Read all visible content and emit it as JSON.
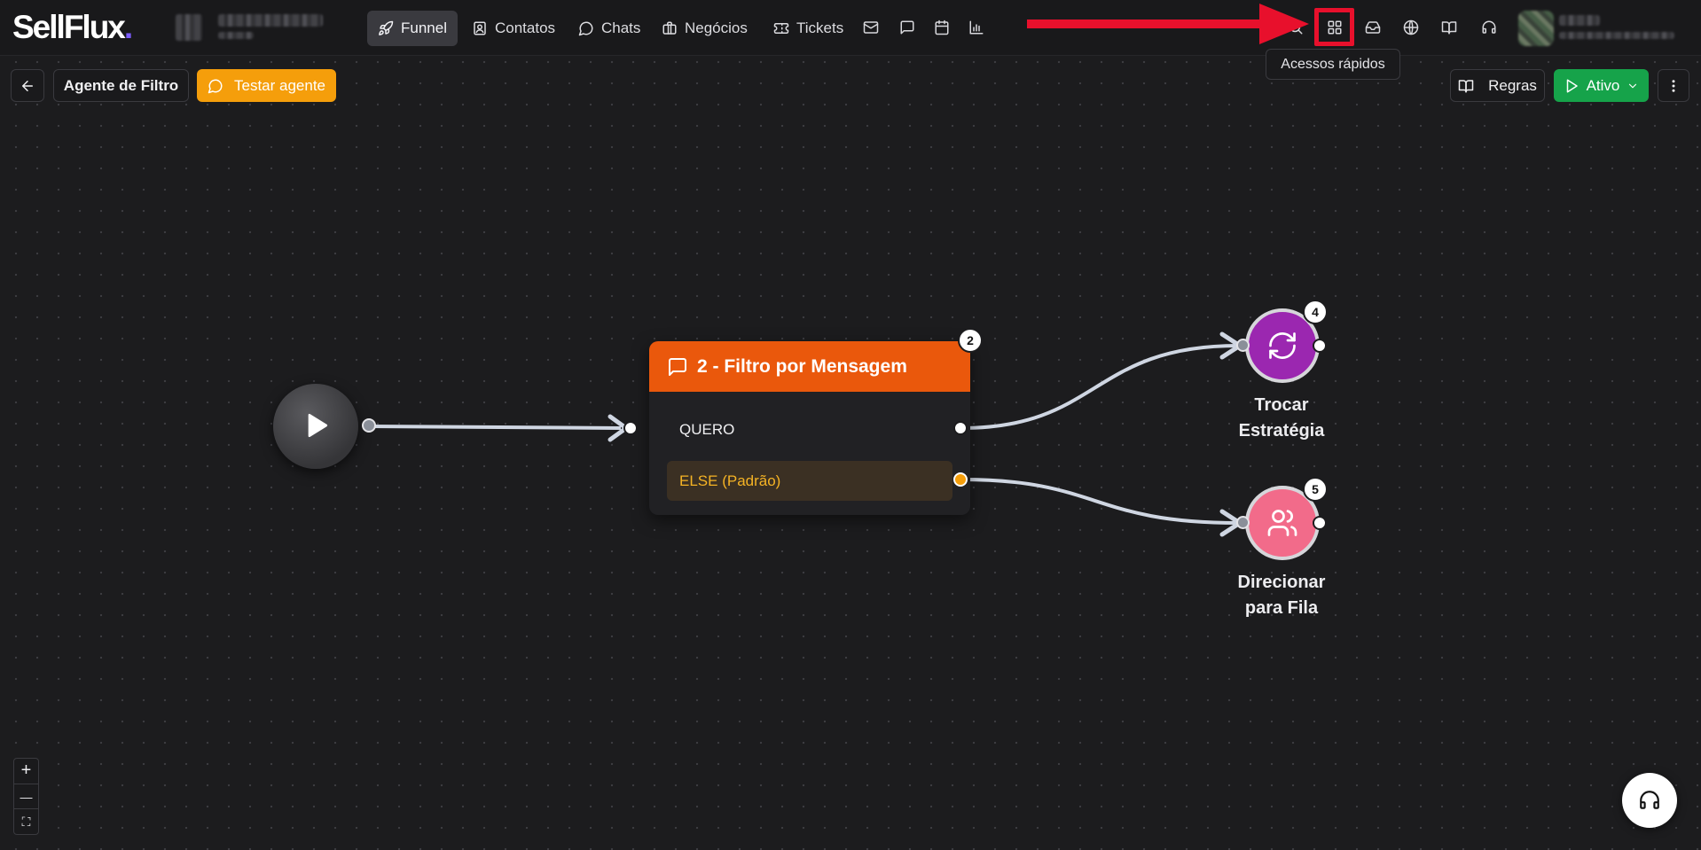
{
  "brand": {
    "logo_text": "SellFlux",
    "logo_dot": "."
  },
  "nav": {
    "items": [
      {
        "label": "Funnel",
        "icon": "rocket-icon",
        "active": true
      },
      {
        "label": "Contatos",
        "icon": "contact-card-icon"
      },
      {
        "label": "Chats",
        "icon": "chat-bubble-icon"
      },
      {
        "label": "Negócios",
        "icon": "briefcase-icon"
      },
      {
        "label": "Tickets",
        "icon": "ticket-icon"
      }
    ],
    "icon_buttons": [
      "mail-icon",
      "message-square-icon",
      "calendar-icon",
      "bar-chart-icon"
    ],
    "right_icons": [
      "search-icon",
      "quick-access-grid-icon",
      "inbox-icon",
      "globe-icon",
      "book-open-icon",
      "headset-icon"
    ],
    "tooltip": "Acessos rápidos"
  },
  "toolbar": {
    "agent_name": "Agente de Filtro",
    "test_label": "Testar agente",
    "rules_label": "Regras",
    "status_label": "Ativo"
  },
  "flow": {
    "filter_node": {
      "badge": "2",
      "title": "2 - Filtro por Mensagem",
      "options": [
        {
          "label": "QUERO"
        },
        {
          "label": "ELSE (Padrão)"
        }
      ]
    },
    "nodes": [
      {
        "badge": "4",
        "label_line1": "Trocar",
        "label_line2": "Estratégia",
        "color": "#9b27b0",
        "icon": "refresh-icon"
      },
      {
        "badge": "5",
        "label_line1": "Direcionar",
        "label_line2": "para Fila",
        "color": "#f26b8a",
        "icon": "users-icon"
      }
    ]
  },
  "controls": {
    "zoom_in": "+",
    "zoom_out": "—",
    "fit": "⛶"
  },
  "colors": {
    "accent_orange": "#f59e0b",
    "node_orange": "#ea580c",
    "status_green": "#16a34a",
    "highlight_red": "#e8102c"
  }
}
